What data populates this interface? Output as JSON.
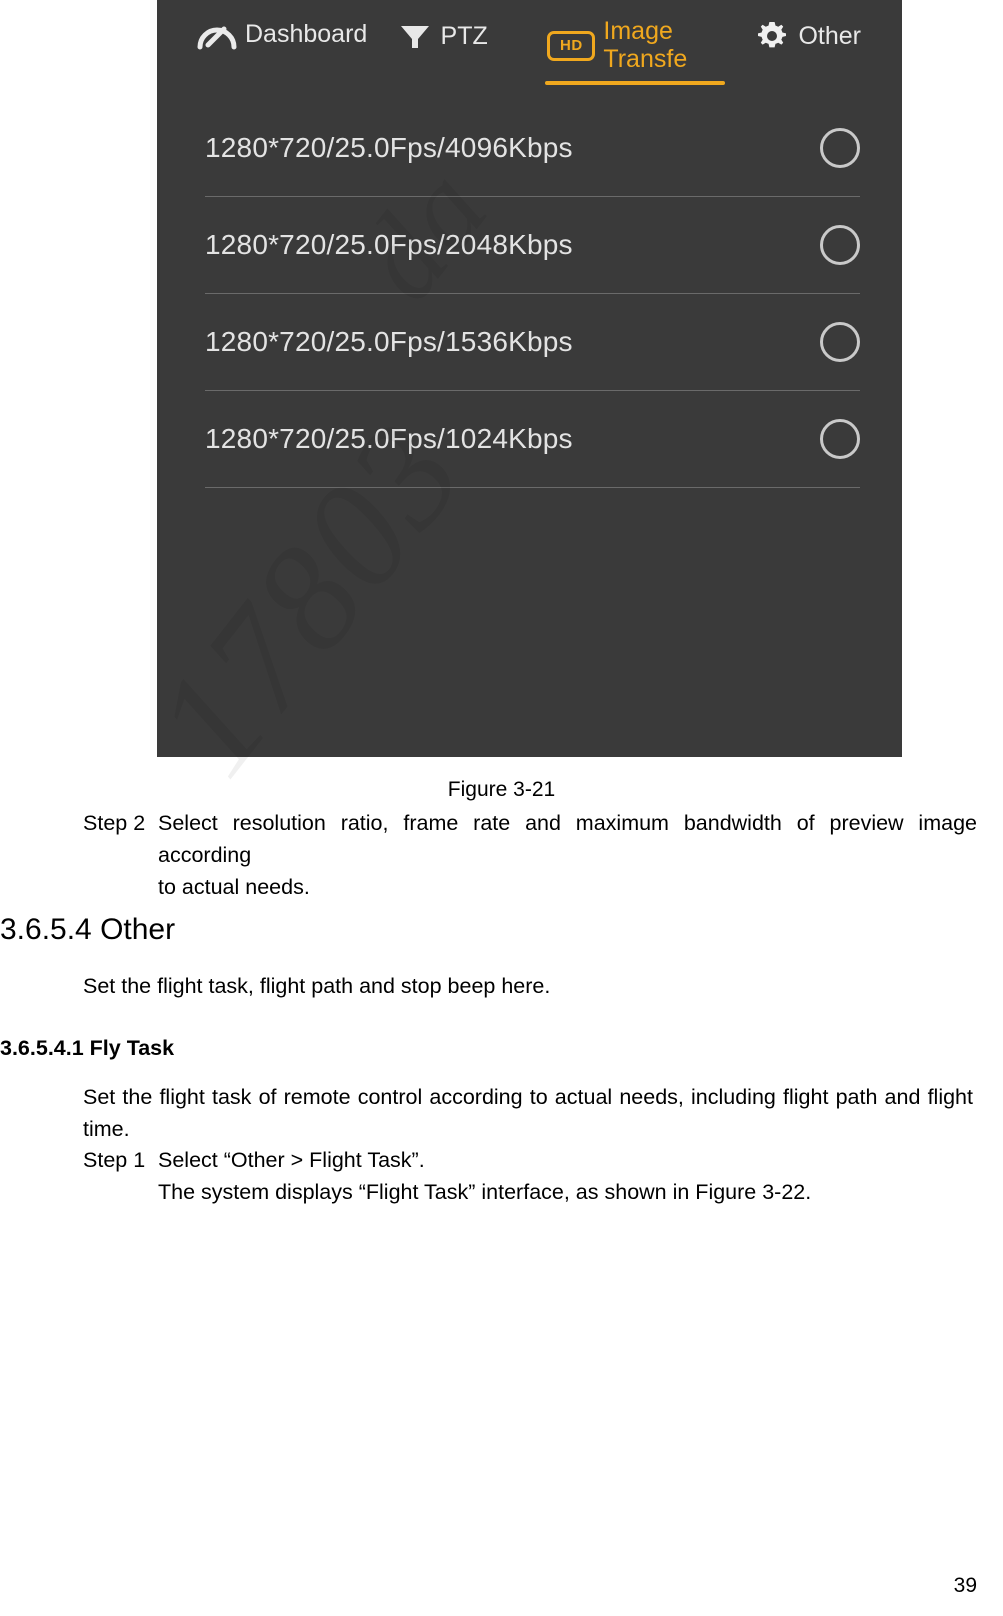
{
  "screenshot": {
    "tabs": [
      {
        "id": "dashboard",
        "label": "Dashboard",
        "icon": "gauge-icon",
        "active": false
      },
      {
        "id": "ptz",
        "label": "PTZ",
        "icon": "ptz-icon",
        "active": false
      },
      {
        "id": "image-transfe",
        "label": "Image Transfe",
        "icon": "hd-icon",
        "badge": "HD",
        "active": true
      },
      {
        "id": "other",
        "label": "Other",
        "icon": "gear-icon",
        "active": false
      }
    ],
    "accent_color": "#f0a81e",
    "background_color": "#3a3a3a",
    "text_color": "#e3e3e3",
    "options": [
      {
        "label": "1280*720/25.0Fps/4096Kbps",
        "selected": false
      },
      {
        "label": "1280*720/25.0Fps/2048Kbps",
        "selected": false
      },
      {
        "label": "1280*720/25.0Fps/1536Kbps",
        "selected": false
      },
      {
        "label": "1280*720/25.0Fps/1024Kbps",
        "selected": false
      }
    ]
  },
  "document": {
    "figure_caption": "Figure 3-21",
    "step2": {
      "tag": "Step 2",
      "text": "Select resolution ratio, frame rate and maximum bandwidth of preview image according",
      "continuation": "to actual needs."
    },
    "section_heading": "3.6.5.4 Other",
    "section_body": "Set the flight task, flight path and stop beep here.",
    "subsection_heading": "3.6.5.4.1 Fly Task",
    "subsection_body": "Set the flight task of remote control according to actual needs, including flight path and flight time.",
    "step1": {
      "tag": "Step 1",
      "text": "Select “Other > Flight Task”.",
      "continuation": "The system displays “Flight Task” interface, as shown in Figure 3-22."
    },
    "page_number": "39",
    "watermark_line1": "da",
    "watermark_line2": "17803"
  }
}
